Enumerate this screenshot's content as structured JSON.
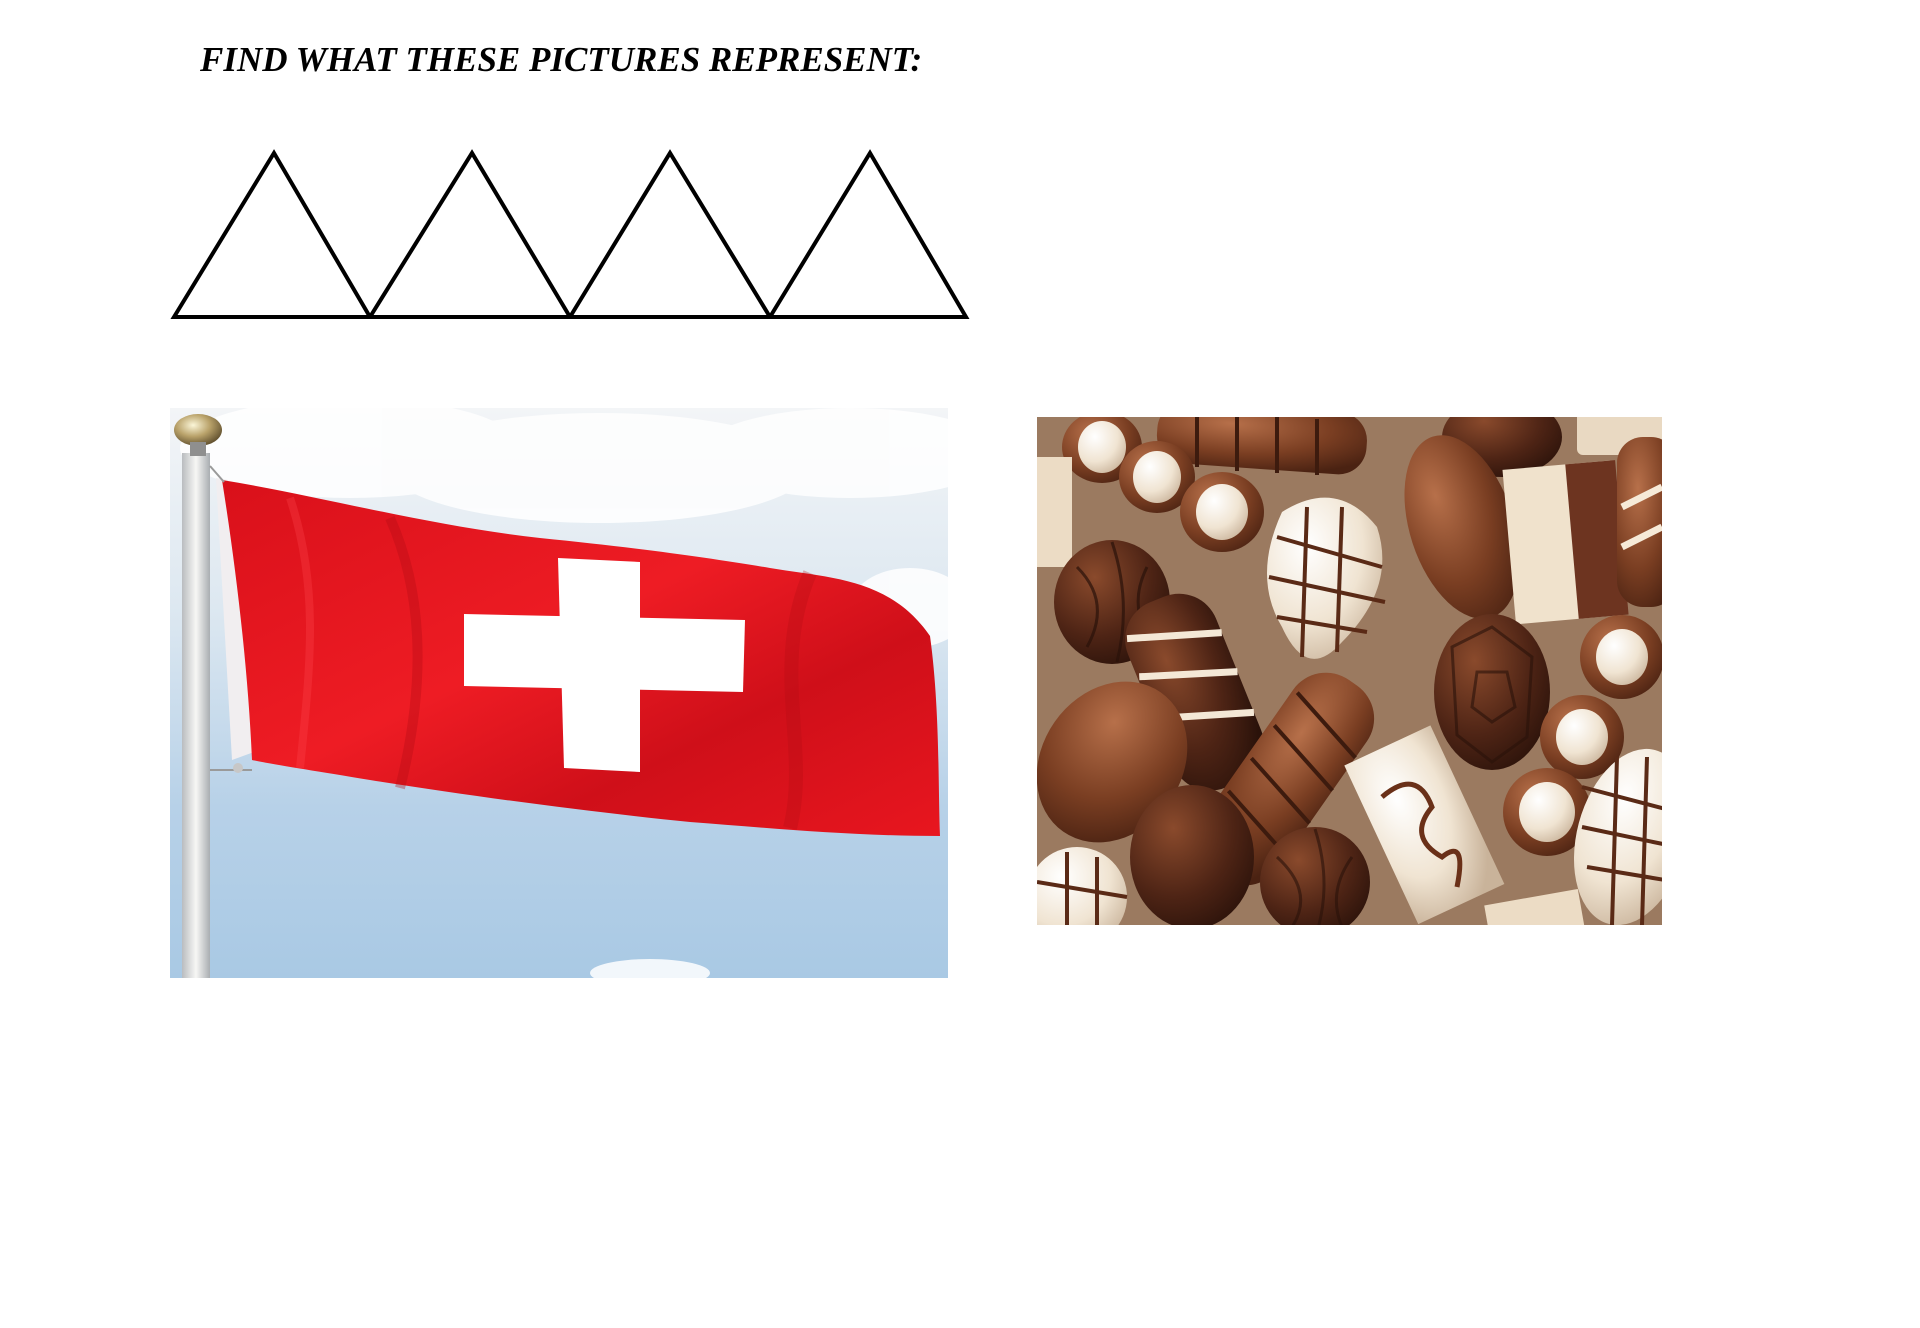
{
  "worksheet": {
    "title": "FIND WHAT THESE PICTURES REPRESENT:"
  },
  "puzzle": {
    "shape": "four outlined triangles in a row",
    "triangle_count": 4
  },
  "pictures": [
    {
      "name": "swiss-flag-photo",
      "depicts": "Swiss flag on a flagpole against a blue sky",
      "flag_red": "#e3141c",
      "cross_white": "#ffffff",
      "sky_blue": "#b9d3ea"
    },
    {
      "name": "chocolates-photo",
      "depicts": "assorted chocolate pralines",
      "dark_brown": "#4a2415",
      "milk_brown": "#7a3f24",
      "white_chocolate": "#f1e6d6",
      "background": "#9b7a60"
    }
  ]
}
